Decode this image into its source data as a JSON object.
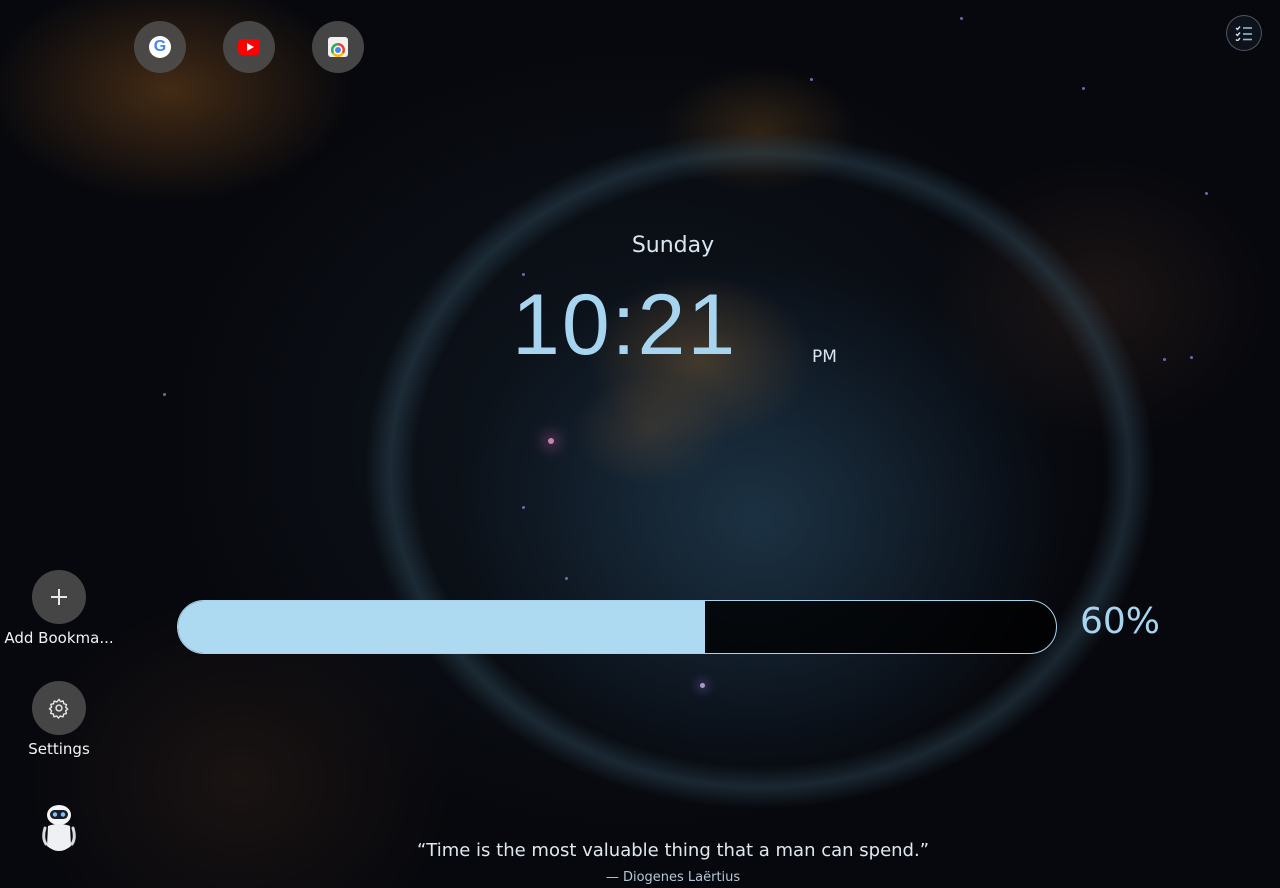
{
  "shortcuts": [
    {
      "name": "Google",
      "icon": "google-icon"
    },
    {
      "name": "YouTube",
      "icon": "youtube-icon"
    },
    {
      "name": "Chrome Web Store",
      "icon": "chrome-web-store-icon"
    }
  ],
  "todo": {
    "icon": "checklist-icon"
  },
  "clock": {
    "day": "Sunday",
    "time": "10:21",
    "ampm": "PM"
  },
  "progress": {
    "percent": 60,
    "label": "60%",
    "fill_color": "#aedaf1"
  },
  "sidebar": {
    "add_bookmark": {
      "label": "Add Bookma...",
      "icon": "plus-icon"
    },
    "settings": {
      "label": "Settings",
      "icon": "gear-icon"
    },
    "mascot": {
      "icon": "robot-icon"
    }
  },
  "quote": {
    "text": "“Time is the most valuable thing that a man can spend.”",
    "author": "— Diogenes Laërtius"
  },
  "colors": {
    "accent": "#a7d4ee",
    "button_bg": "#505050"
  }
}
